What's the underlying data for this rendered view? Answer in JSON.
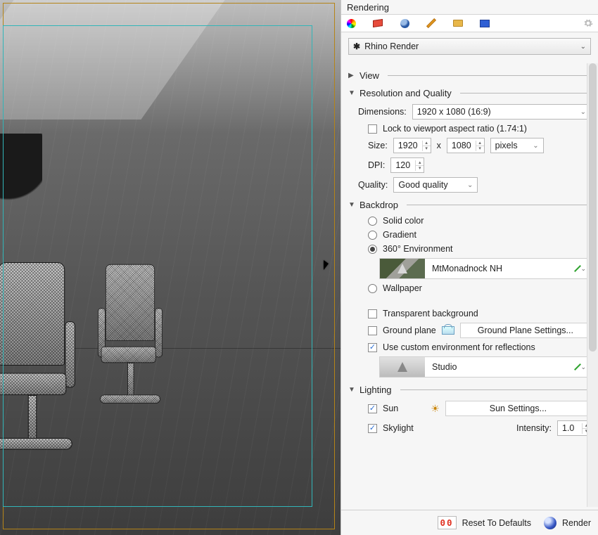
{
  "panel_title": "Rendering",
  "renderer": {
    "name": "Rhino Render"
  },
  "sections": {
    "view": {
      "label": "View",
      "expanded": false
    },
    "resq": {
      "label": "Resolution and Quality",
      "dimensions_label": "Dimensions:",
      "dimensions_value": "1920 x 1080 (16:9)",
      "lock_label": "Lock to viewport aspect ratio (1.74:1)",
      "lock_checked": false,
      "size_label": "Size:",
      "size_w": "1920",
      "size_x": "x",
      "size_h": "1080",
      "units": "pixels",
      "dpi_label": "DPI:",
      "dpi_value": "120",
      "quality_label": "Quality:",
      "quality_value": "Good quality"
    },
    "backdrop": {
      "label": "Backdrop",
      "opt_solid": "Solid color",
      "opt_gradient": "Gradient",
      "opt_env": "360° Environment",
      "env_name": "MtMonadnock NH",
      "opt_wallpaper": "Wallpaper",
      "selected": "env",
      "transparent_label": "Transparent background",
      "transparent_checked": false,
      "ground_label": "Ground plane",
      "ground_checked": false,
      "ground_settings": "Ground Plane Settings...",
      "custom_refl_label": "Use custom environment for reflections",
      "custom_refl_checked": true,
      "refl_env_name": "Studio"
    },
    "lighting": {
      "label": "Lighting",
      "sun_label": "Sun",
      "sun_checked": true,
      "sun_settings": "Sun Settings...",
      "skylight_label": "Skylight",
      "skylight_checked": true,
      "intensity_label": "Intensity:",
      "intensity_value": "1.0"
    }
  },
  "footer": {
    "reset_label": "Reset To Defaults",
    "reset_digits": "00",
    "render_label": "Render"
  }
}
